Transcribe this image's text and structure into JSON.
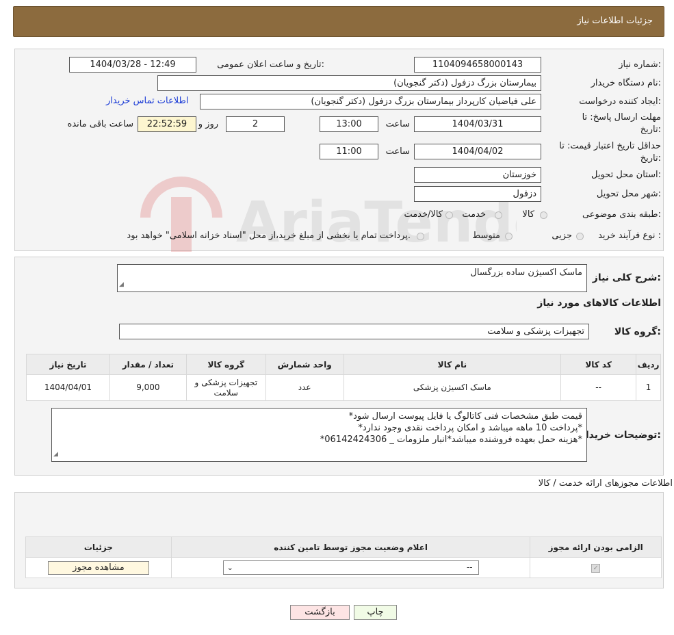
{
  "header": {
    "title": "جزئیات اطلاعات نیاز"
  },
  "fields": {
    "need_number_label": "شماره نیاز:",
    "need_number": "1104094658000143",
    "announce_label": "تاریخ و ساعت اعلان عمومی:",
    "announce_value": "1404/03/28 - 12:49",
    "buyer_label": "نام دستگاه خریدار:",
    "buyer_value": "بیمارستان بزرگ دزفول (دکتر گنجویان)",
    "creator_label": "ایجاد کننده درخواست:",
    "creator_value": "علی فیاضیان کارپرداز بیمارستان بزرگ دزفول (دکتر گنجویان)",
    "contact_link": "اطلاعات تماس خریدار",
    "deadline_label_1": "مهلت ارسال پاسخ: تا",
    "deadline_label_2": "تاریخ:",
    "deadline_date": "1404/03/31",
    "time_label": "ساعت",
    "deadline_time": "13:00",
    "days_value": "2",
    "days_label": "روز و",
    "remaining_value": "22:52:59",
    "remaining_label": "ساعت باقی مانده",
    "validity_label_1": "حداقل تاریخ اعتبار قیمت: تا",
    "validity_label_2": "تاریخ:",
    "validity_date": "1404/04/02",
    "validity_time": "11:00",
    "province_label": "استان محل تحویل:",
    "province_value": "خوزستان",
    "city_label": "شهر محل تحویل:",
    "city_value": "دزفول",
    "category_label": "طبقه بندی موضوعی:",
    "cat_goods": "کالا",
    "cat_service": "خدمت",
    "cat_both": "کالا/خدمت",
    "process_label": "نوع فرآیند خرید :",
    "proc_partial": "جزیی",
    "proc_medium": "متوسط",
    "proc_note": "پرداخت تمام یا بخشی از مبلغ خرید،از محل \"اسناد خزانه اسلامی\" خواهد بود."
  },
  "summary": {
    "label": "شرح کلی نیاز:",
    "value": "ماسک اکسیژن ساده بزرگسال",
    "goods_info_title": "اطلاعات کالاهای مورد نیاز",
    "group_label": "گروه کالا:",
    "group_value": "تجهیزات پزشکی و سلامت"
  },
  "goods_table": {
    "headers": [
      "ردیف",
      "کد کالا",
      "نام کالا",
      "واحد شمارش",
      "گروه کالا",
      "تعداد / مقدار",
      "تاریخ نیاز"
    ],
    "rows": [
      [
        "1",
        "--",
        "ماسک اکسیژن پزشکی",
        "عدد",
        "تجهیزات پزشکی و سلامت",
        "9,000",
        "1404/04/01"
      ]
    ]
  },
  "buyer_notes": {
    "label": "توضیحات خریدار:",
    "lines": [
      "قیمت طبق مشخصات فنی کاتالوگ یا فایل پیوست ارسال شود*",
      "*پرداخت 10 ماهه میباشد و امکان پرداخت نقدی وجود ندارد*",
      "*هزینه حمل بعهده فروشنده میباشد*انبار ملزومات _ 06142424306*"
    ]
  },
  "permits": {
    "title": "اطلاعات مجوزهای ارائه خدمت / کالا",
    "headers": [
      "الزامی بودن ارائه مجوز",
      "اعلام وضعیت مجوز توسط تامین کننده",
      "جزئیات"
    ],
    "select_value": "--",
    "view_button": "مشاهده مجوز"
  },
  "buttons": {
    "print": "چاپ",
    "back": "بازگشت"
  },
  "watermark": {
    "text": "AriaTender.neT"
  },
  "colors": {
    "header_bg": "#8c6b3e",
    "remaining_bg": "#fdf6d0",
    "link": "#1a3bd6"
  }
}
